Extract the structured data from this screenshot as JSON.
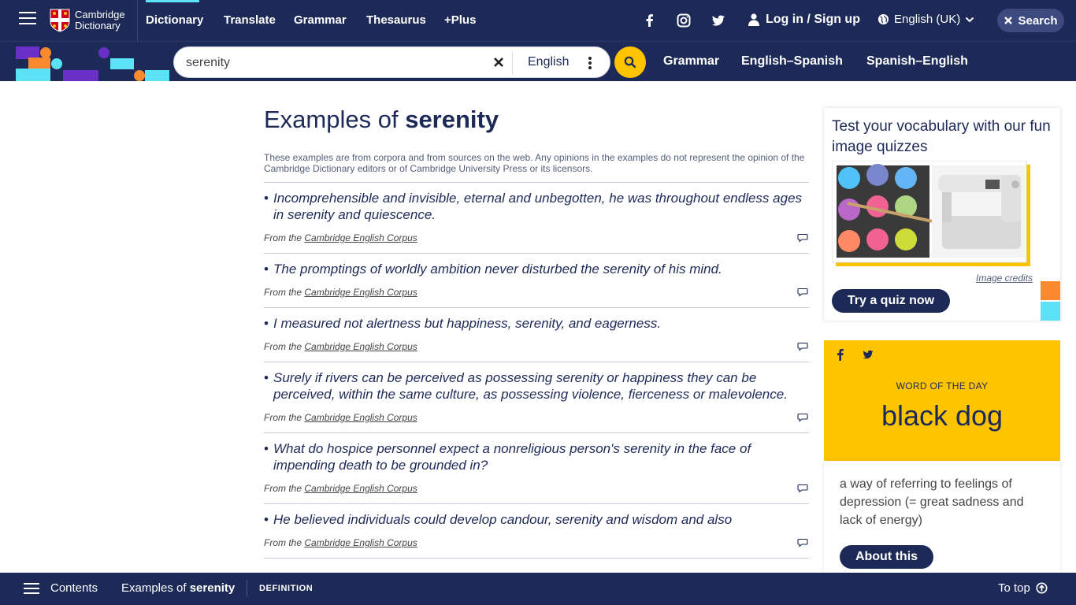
{
  "header": {
    "logo_line1": "Cambridge",
    "logo_line2": "Dictionary",
    "nav": [
      "Dictionary",
      "Translate",
      "Grammar",
      "Thesaurus",
      "+Plus"
    ],
    "login": "Log in / Sign up",
    "language": "English (UK)",
    "search_button": "Search"
  },
  "searchbar": {
    "query": "serenity",
    "dictionary": "English",
    "links": [
      "Grammar",
      "English–Spanish",
      "Spanish–English"
    ]
  },
  "main": {
    "title_prefix": "Examples of",
    "title_word": "serenity",
    "disclaimer": "These examples are from corpora and from sources on the web. Any opinions in the examples do not represent the opinion of the Cambridge Dictionary editors or of Cambridge University Press or its licensors.",
    "source_prefix": "From the",
    "source_link": "Cambridge English Corpus",
    "examples": [
      "Incomprehensible and invisible, eternal and unbegotten, he was throughout endless ages in serenity and quiescence.",
      "The promptings of worldly ambition never disturbed the serenity of his mind.",
      "I measured not alertness but happiness, serenity, and eagerness.",
      "Surely if rivers can be perceived as possessing serenity or happiness they can be perceived, within the same culture, as possessing violence, fierceness or malevolence.",
      "What do hospice personnel expect a nonreligious person's serenity in the face of impending death to be grounded in?",
      "He believed individuals could develop candour, serenity and wisdom and also"
    ]
  },
  "sidebar": {
    "quiz_title": "Test your vocabulary with our fun image quizzes",
    "image_credits": "Image credits",
    "quiz_button": "Try a quiz now",
    "wotd_label": "WORD OF THE DAY",
    "wotd_word": "black dog",
    "wotd_definition": "a way of referring to feelings of depression (= great sadness and lack of energy)",
    "about_button": "About this"
  },
  "bottombar": {
    "contents": "Contents",
    "examples_prefix": "Examples of",
    "examples_word": "serenity",
    "definition": "DEFINITION",
    "to_top": "To top"
  },
  "colors": {
    "navy": "#1d2a57",
    "yellow": "#fec400",
    "cyan": "#5ce2f7",
    "purple": "#6a2fc7",
    "orange": "#fb8a2e"
  }
}
